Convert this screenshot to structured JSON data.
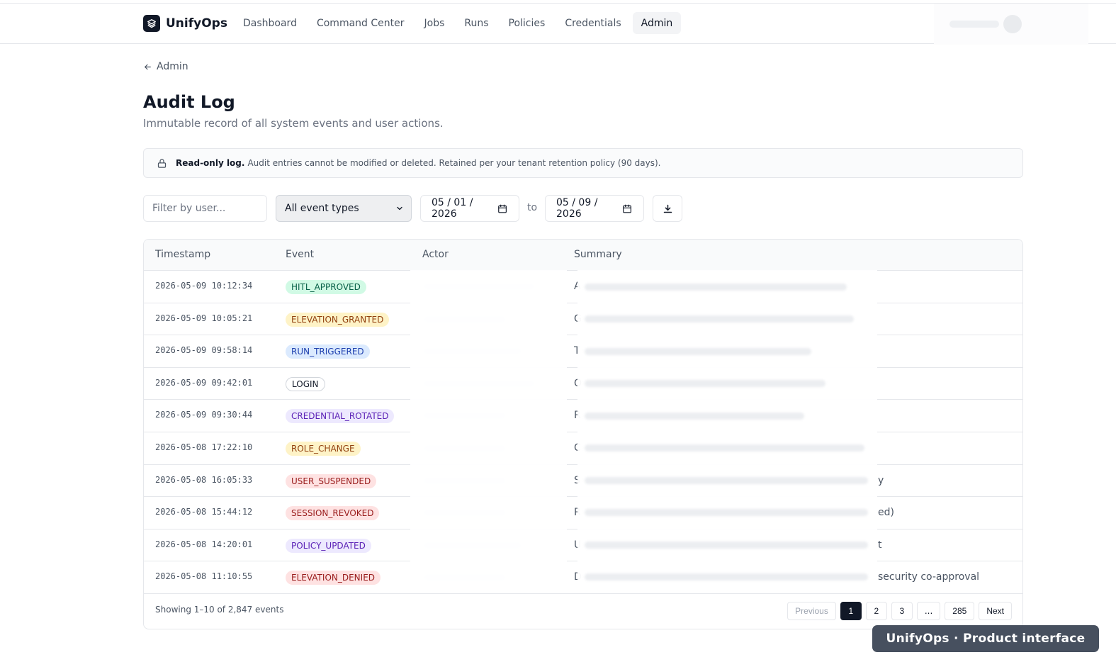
{
  "brand": {
    "name": "UnifyOps"
  },
  "nav": [
    {
      "label": "Dashboard"
    },
    {
      "label": "Command Center"
    },
    {
      "label": "Jobs"
    },
    {
      "label": "Runs"
    },
    {
      "label": "Policies"
    },
    {
      "label": "Credentials"
    },
    {
      "label": "Admin",
      "active": true
    }
  ],
  "breadcrumb": {
    "back_label": "Admin",
    "icon": "arrow-left-icon"
  },
  "page": {
    "title": "Audit Log",
    "subtitle": "Immutable record of all system events and user actions."
  },
  "notice": {
    "icon": "lock-icon",
    "strong": "Read-only log.",
    "text": "Audit entries cannot be modified or deleted. Retained per your tenant retention policy (90 days)."
  },
  "filters": {
    "user_placeholder": "Filter by user...",
    "event_type_selected": "All event types",
    "date_from": "05 / 01 / 2026",
    "date_to": "05 / 09 / 2026",
    "to_label": "to",
    "export_icon": "download-icon"
  },
  "table": {
    "headers": [
      "Timestamp",
      "Event",
      "Actor",
      "Summary"
    ],
    "rows": [
      {
        "timestamp": "2026-05-09 10:12:34",
        "event": "HITL_APPROVED",
        "summary": "A"
      },
      {
        "timestamp": "2026-05-09 10:05:21",
        "event": "ELEVATION_GRANTED",
        "summary": "G"
      },
      {
        "timestamp": "2026-05-09 09:58:14",
        "event": "RUN_TRIGGERED",
        "summary": "T"
      },
      {
        "timestamp": "2026-05-09 09:42:01",
        "event": "LOGIN",
        "summary": "O"
      },
      {
        "timestamp": "2026-05-09 09:30:44",
        "event": "CREDENTIAL_ROTATED",
        "summary": "R"
      },
      {
        "timestamp": "2026-05-08 17:22:10",
        "event": "ROLE_CHANGE",
        "summary": "C"
      },
      {
        "timestamp": "2026-05-08 16:05:33",
        "event": "USER_SUSPENDED",
        "summary": "S",
        "tail": "y"
      },
      {
        "timestamp": "2026-05-08 15:44:12",
        "event": "SESSION_REVOKED",
        "summary": "R",
        "tail": "ed)"
      },
      {
        "timestamp": "2026-05-08 14:20:01",
        "event": "POLICY_UPDATED",
        "summary": "U",
        "tail": "t"
      },
      {
        "timestamp": "2026-05-08 11:10:55",
        "event": "ELEVATION_DENIED",
        "summary": "D",
        "tail": "security co-approval"
      }
    ]
  },
  "footer": {
    "showing": "Showing 1–10 of 2,847 events",
    "pagination": {
      "previous": "Previous",
      "pages": [
        "1",
        "2",
        "3",
        "...",
        "285"
      ],
      "current": "1",
      "next": "Next"
    }
  },
  "watermark": "UnifyOps · Product interface",
  "colors": {
    "primary": "#111827",
    "badge_green": "#d1fae5",
    "badge_amber": "#fef3c7",
    "badge_blue": "#dbeafe",
    "badge_purple": "#ede9fe",
    "badge_red": "#fee2e2"
  }
}
